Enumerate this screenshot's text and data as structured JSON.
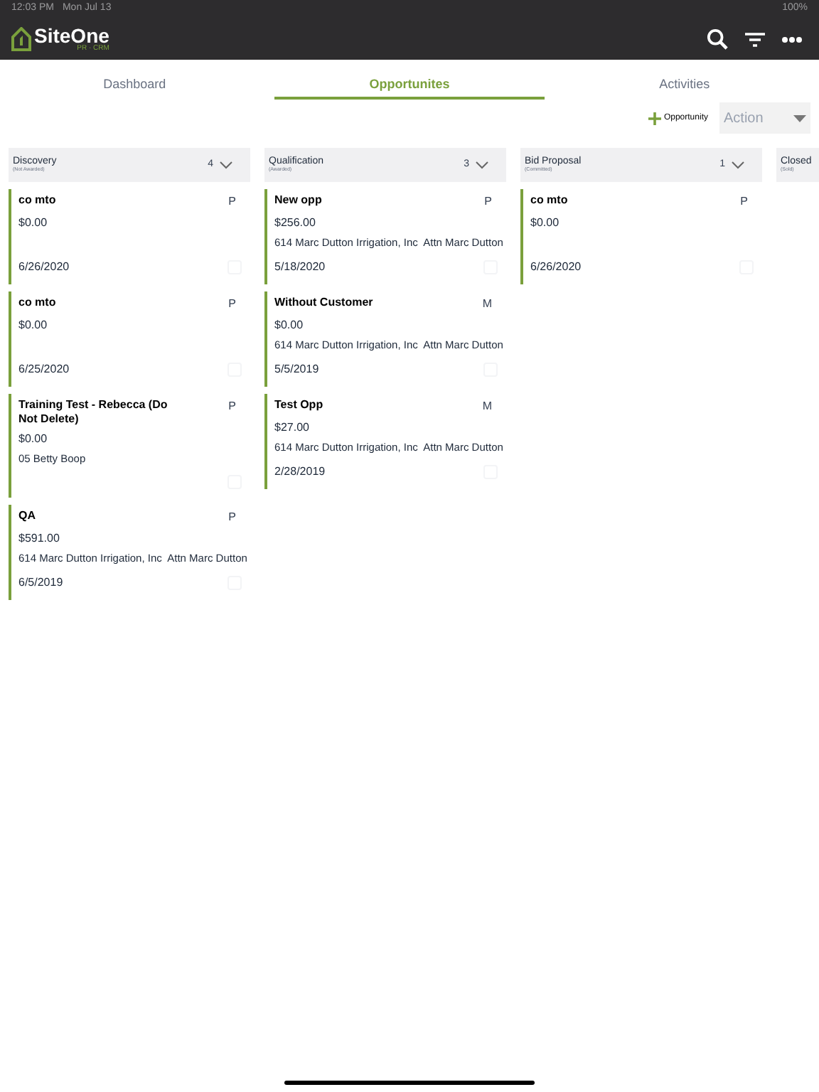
{
  "status_bar": {
    "time": "12:03 PM",
    "date": "Mon Jul 13",
    "battery": "100%"
  },
  "app_bar": {
    "logo": "SiteOne",
    "logo_sub": "PR · CRM"
  },
  "tabs": [
    {
      "label": "Dashboard",
      "selected": false
    },
    {
      "label": "Opportunites",
      "selected": true
    },
    {
      "label": "Activities",
      "selected": false
    }
  ],
  "toolbar": {
    "add_label": "Opportunity",
    "action_placeholder": "Action"
  },
  "columns": [
    {
      "title": "Discovery",
      "subtitle": "(Not Awarded)",
      "count": "4",
      "cards": [
        {
          "title": "co mto",
          "tag": "P",
          "amount": "$0.00",
          "date": "6/26/2020",
          "checked": false
        },
        {
          "title": "co mto",
          "tag": "P",
          "amount": "$0.00",
          "date": "6/25/2020",
          "checked": false
        },
        {
          "title": "Training Test - Rebecca (Do Not Delete)",
          "tag": "P",
          "amount": "$0.00",
          "account": "05 Betty Boop",
          "checked": false
        },
        {
          "title": "QA",
          "tag": "P",
          "amount": "$591.00",
          "account": "614 Marc Dutton Irrigation, Inc  Attn Marc Dutton",
          "date": "6/5/2019",
          "checked": false
        }
      ]
    },
    {
      "title": "Qualification",
      "subtitle": "(Awarded)",
      "count": "3",
      "cards": [
        {
          "title": "New opp",
          "tag": "P",
          "amount": "$256.00",
          "account": "614 Marc Dutton Irrigation, Inc  Attn Marc Dutton",
          "date": "5/18/2020",
          "checked": false
        },
        {
          "title": "Without Customer",
          "tag": "M",
          "amount": "$0.00",
          "account": "614 Marc Dutton Irrigation, Inc  Attn Marc Dutton",
          "date": "5/5/2019",
          "checked": false
        },
        {
          "title": "Test Opp",
          "tag": "M",
          "amount": "$27.00",
          "account": "614 Marc Dutton Irrigation, Inc  Attn Marc Dutton",
          "date": "2/28/2019",
          "checked": false
        }
      ]
    },
    {
      "title": "Bid Proposal",
      "subtitle": "(Committed)",
      "count": "1",
      "cards": [
        {
          "title": "co mto",
          "tag": "P",
          "amount": "$0.00",
          "date": "6/26/2020",
          "checked": false
        }
      ]
    },
    {
      "title": "Closed",
      "subtitle": "(Sold)"
    }
  ]
}
